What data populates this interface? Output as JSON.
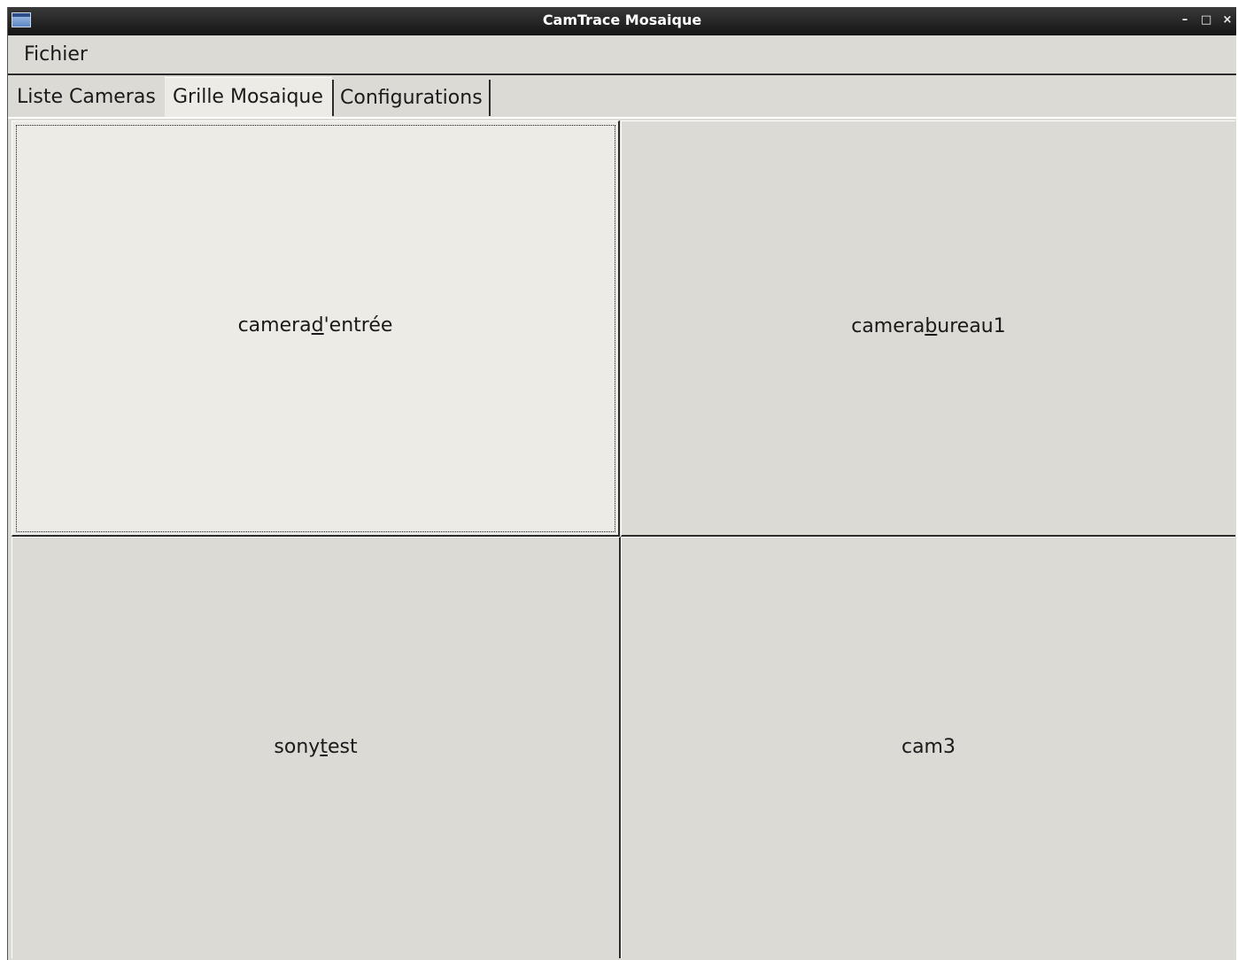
{
  "window": {
    "title": "CamTrace Mosaique",
    "icons": {
      "app": "app-window-icon",
      "minimize": "minimize-icon",
      "maximize": "maximize-icon",
      "close": "close-icon"
    },
    "controls": {
      "minimize": "–",
      "maximize": "□",
      "close": "×"
    }
  },
  "menubar": {
    "items": [
      {
        "label": "Fichier"
      }
    ]
  },
  "tabs": [
    {
      "label": "Liste Cameras",
      "active": false
    },
    {
      "label": "Grille Mosaique",
      "active": true
    },
    {
      "label": "Configurations",
      "active": false
    }
  ],
  "grid": {
    "cells": [
      {
        "before": "camera",
        "mnemonic": "d",
        "after": "'entrée",
        "focused": true
      },
      {
        "before": "camera",
        "mnemonic": "b",
        "after": "ureau1",
        "focused": false
      },
      {
        "before": "sony",
        "mnemonic": "t",
        "after": "est",
        "focused": false
      },
      {
        "before": "cam3",
        "mnemonic": "",
        "after": "",
        "focused": false
      }
    ]
  },
  "colors": {
    "window_bg": "#dcdad5",
    "active_bg": "#edebe6",
    "titlebar": "#1e1e1e",
    "border_dark": "#2b2b2b"
  }
}
